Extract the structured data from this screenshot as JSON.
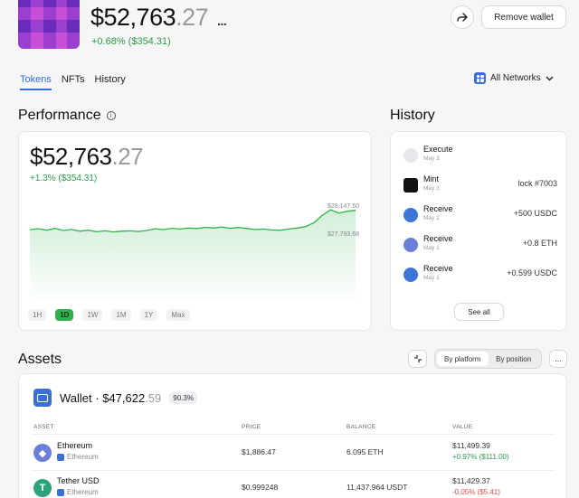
{
  "header": {
    "value_main": "$52,763",
    "value_decimal": ".27",
    "more": "...",
    "change": "+0.68% ($354.31)",
    "remove_label": "Remove wallet"
  },
  "tabs": [
    {
      "label": "Tokens",
      "active": true
    },
    {
      "label": "NFTs",
      "active": false
    },
    {
      "label": "History",
      "active": false
    }
  ],
  "networks": {
    "label": "All Networks"
  },
  "performance": {
    "title": "Performance",
    "value_main": "$52,763",
    "value_decimal": ".27",
    "change": "+1.3% ($354.31)",
    "high_label": "$28,147.50",
    "low_label": "$27,793.68",
    "ranges": [
      "1H",
      "1D",
      "1W",
      "1M",
      "1Y",
      "Max"
    ],
    "active_range": "1D"
  },
  "chart_data": {
    "type": "area",
    "series": [
      {
        "values": [
          27985,
          27992,
          27980,
          27995,
          27978,
          27986,
          27972,
          27980,
          27968,
          27975,
          27966,
          27972,
          27975,
          27970,
          27978,
          27992,
          27985,
          27996,
          27990,
          27998,
          27994,
          28004,
          27998,
          28006,
          27996,
          28002,
          27994,
          27985,
          27990,
          27982,
          27980,
          27990,
          27998,
          28010,
          28040,
          28100,
          28147,
          28120,
          28135,
          28142
        ]
      }
    ],
    "annotations": [
      "$28,147.50",
      "$27,793.68"
    ],
    "ylim": [
      27793.68,
      28147.5
    ],
    "color": "#2fb24c"
  },
  "history": {
    "title": "History",
    "items": [
      {
        "label": "Execute",
        "date": "May 3",
        "amount": "",
        "color": "#e8e8ec"
      },
      {
        "label": "Mint",
        "date": "May 3",
        "amount": "lock #7003",
        "color": "#111111"
      },
      {
        "label": "Receive",
        "date": "May 2",
        "amount": "+500 USDC",
        "color": "#3d74d6"
      },
      {
        "label": "Receive",
        "date": "May 1",
        "amount": "+0.8 ETH",
        "color": "#6b7fd8"
      },
      {
        "label": "Receive",
        "date": "May 1",
        "amount": "+0.599 USDC",
        "color": "#3d74d6"
      }
    ],
    "see_all": "See all"
  },
  "assets": {
    "title": "Assets",
    "segments": [
      "By platform",
      "By position"
    ],
    "active_segment": "By platform",
    "menu": "...",
    "wallet": {
      "name": "Wallet · $47,622",
      "decimal": ".59",
      "pct": "90.3%"
    },
    "columns": [
      "ASSET",
      "PRICE",
      "BALANCE",
      "VALUE"
    ],
    "rows": [
      {
        "name": "Ethereum",
        "network": "Ethereum",
        "price": "$1,886.47",
        "balance": "6.095 ETH",
        "value": "$11,499.39",
        "change": "+0.97% ($111.00)",
        "positive": true,
        "icon_color": "#6b7fd8",
        "icon_glyph": "◆"
      },
      {
        "name": "Tether USD",
        "network": "Ethereum",
        "price": "$0.999248",
        "balance": "11,437.964 USDT",
        "value": "$11,429.37",
        "change": "-0.05% ($5.41)",
        "positive": false,
        "icon_color": "#2aa37a",
        "icon_glyph": "T"
      }
    ]
  },
  "colors": {
    "accent": "#2f6fd6",
    "positive": "#2a9d48",
    "negative": "#e04b4b",
    "avatar": "#9b3fd0"
  }
}
